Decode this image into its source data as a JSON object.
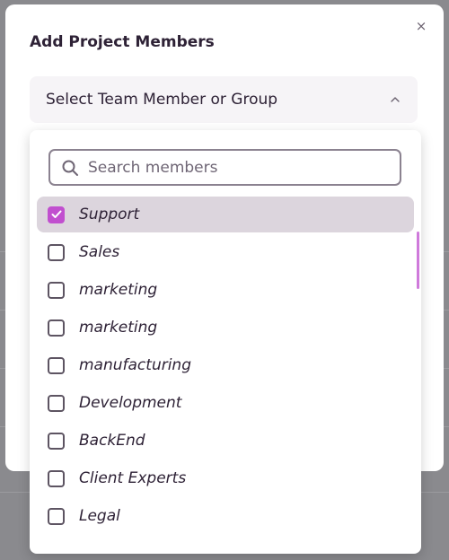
{
  "modal": {
    "title": "Add Project Members",
    "close_label": "×"
  },
  "select": {
    "label": "Select Team Member or Group",
    "icon": "chevron-up-icon"
  },
  "search": {
    "placeholder": "Search members",
    "value": ""
  },
  "members": [
    {
      "label": "Support",
      "checked": true
    },
    {
      "label": "Sales",
      "checked": false
    },
    {
      "label": "marketing",
      "checked": false
    },
    {
      "label": "marketing",
      "checked": false
    },
    {
      "label": "manufacturing",
      "checked": false
    },
    {
      "label": "Development",
      "checked": false
    },
    {
      "label": "BackEnd",
      "checked": false
    },
    {
      "label": "Client Experts",
      "checked": false
    },
    {
      "label": "Legal",
      "checked": false
    }
  ],
  "colors": {
    "accent": "#c14fcf",
    "selected_row": "#dcd5dd",
    "text": "#2e2236"
  }
}
